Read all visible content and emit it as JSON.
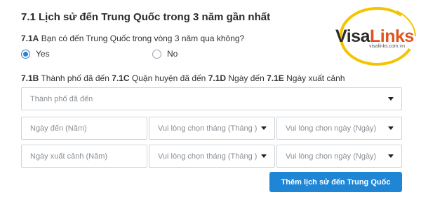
{
  "section": {
    "title": "7.1 Lịch sử đến Trung Quốc trong 3 năm gần nhất"
  },
  "question": {
    "code": "7.1A",
    "text": " Bạn có đến Trung Quốc trong vòng 3 năm qua không?"
  },
  "radios": {
    "yes_label": "Yes",
    "no_label": "No",
    "selected": "Yes"
  },
  "subhead": {
    "c1": "7.1B",
    "t1": " Thành phố đã đến ",
    "c2": "7.1C",
    "t2": " Quận huyện đã đến ",
    "c3": "7.1D",
    "t3": " Ngày đến ",
    "c4": "7.1E",
    "t4": " Ngày xuất cảnh"
  },
  "fields": {
    "city_placeholder": "Thành phố đã đến",
    "arrival_year": "Ngày đến (Năm)",
    "arrival_month": "Vui lòng chọn tháng (Tháng )",
    "arrival_day": "Vui lòng chọn ngày (Ngày)",
    "exit_year": "Ngày xuất cảnh (Năm)",
    "exit_month": "Vui lòng chọn tháng (Tháng )",
    "exit_day": "Vui lòng chọn ngày (Ngày)"
  },
  "actions": {
    "add_button": "Thêm lịch sử đến Trung Quốc"
  },
  "logo": {
    "visa": "Visa",
    "links": "Links",
    "url": "visalinks.com.vn"
  },
  "colors": {
    "accent": "#1f86d6",
    "logo_orange": "#e0531f",
    "logo_yellow": "#f5c400"
  }
}
